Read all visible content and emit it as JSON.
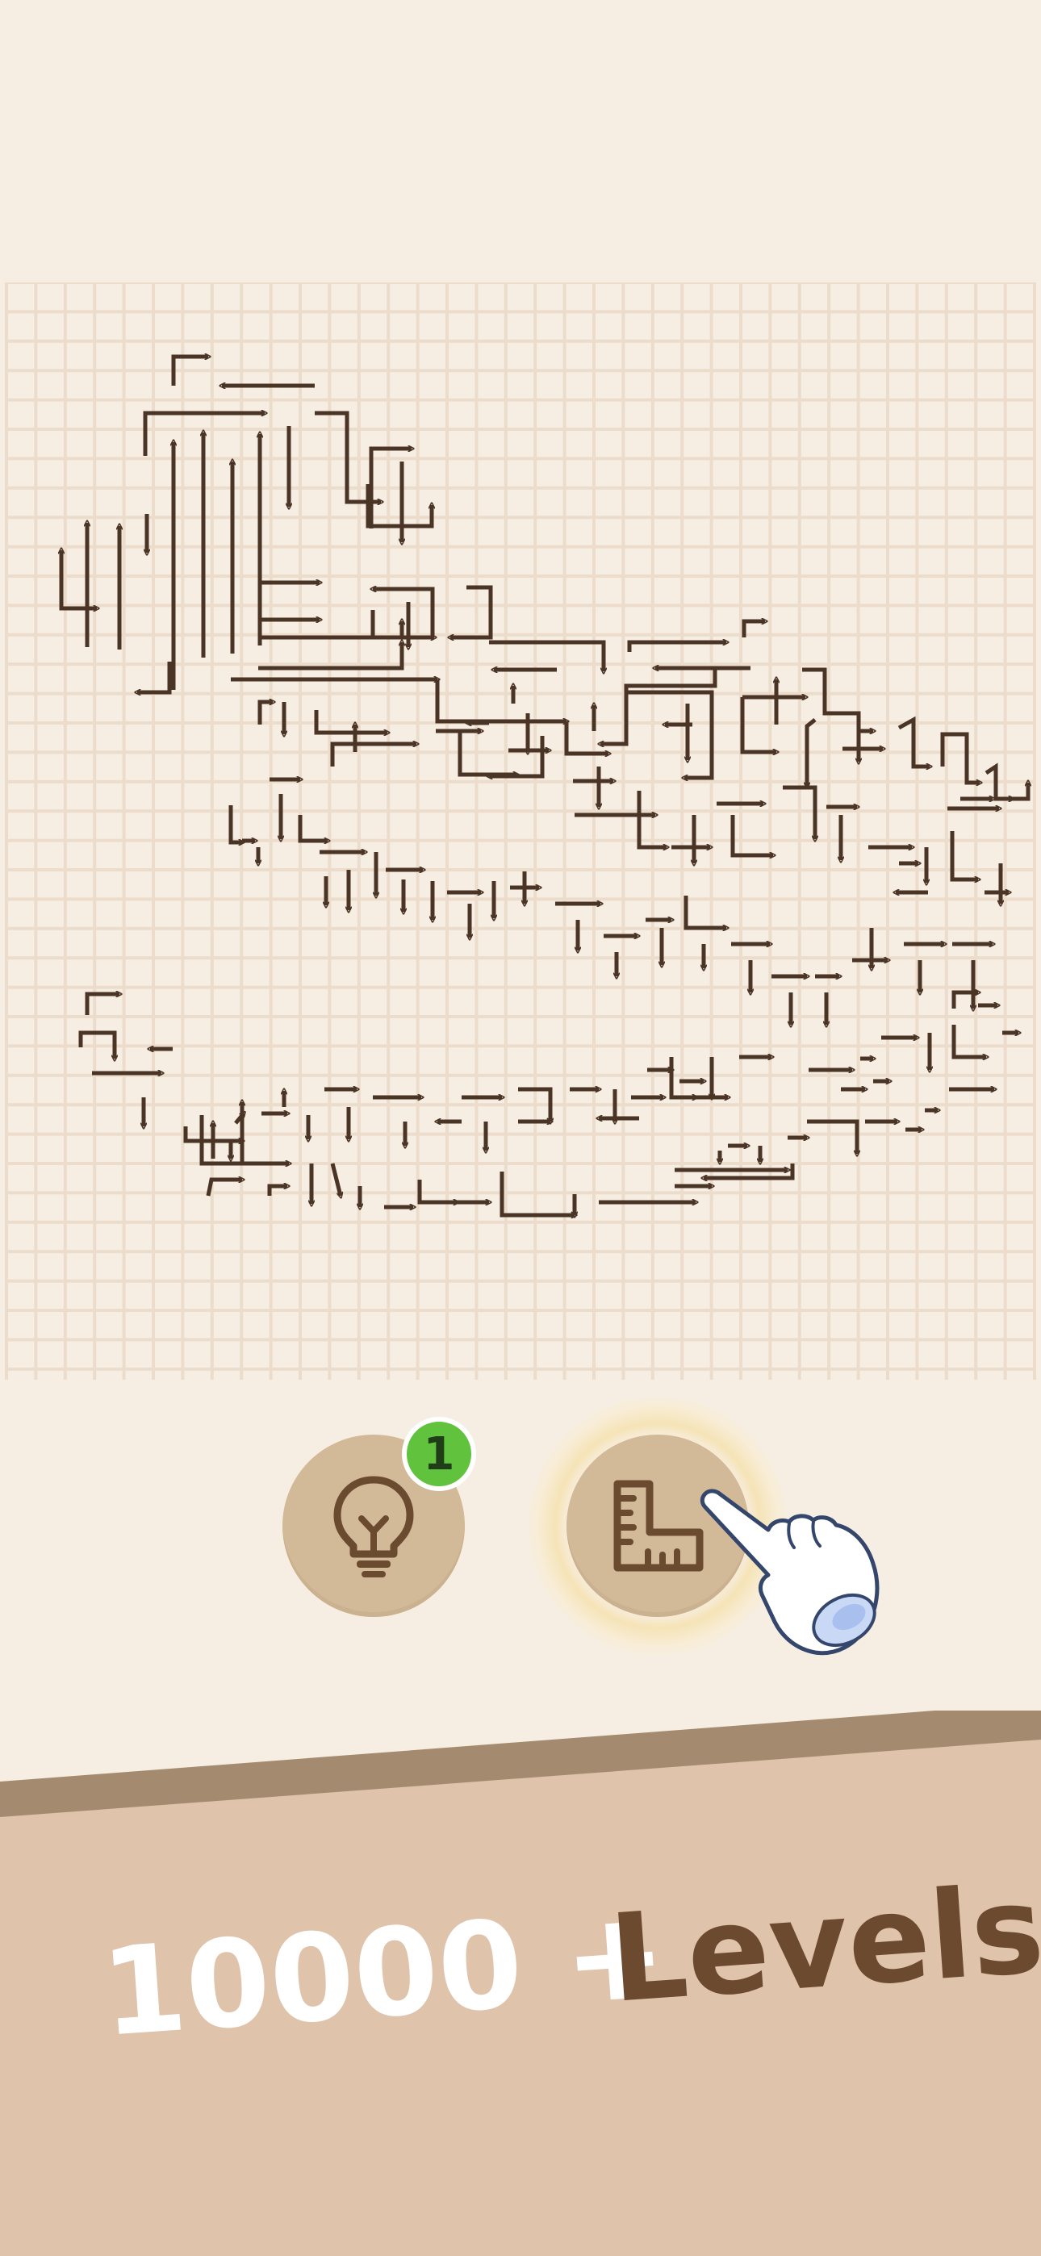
{
  "board": {
    "colors": {
      "background": "#f7eee3",
      "grid": "#ecdccb",
      "arrow": "#4a3426"
    }
  },
  "tools": {
    "hint": {
      "icon": "lightbulb-icon",
      "badge_count": "1"
    },
    "ruler": {
      "icon": "ruler-icon"
    },
    "pointer": {
      "icon": "pointing-hand-icon"
    },
    "colors": {
      "button": "#d2b997",
      "icon": "#6b4b30",
      "badge": "#61c33d"
    }
  },
  "footer": {
    "number_text": "10000 +",
    "word_text": "Levels",
    "colors": {
      "band": "#dfc3ab",
      "stripe": "#a48b6f",
      "number": "#ffffff",
      "word": "#6b4a30"
    }
  }
}
